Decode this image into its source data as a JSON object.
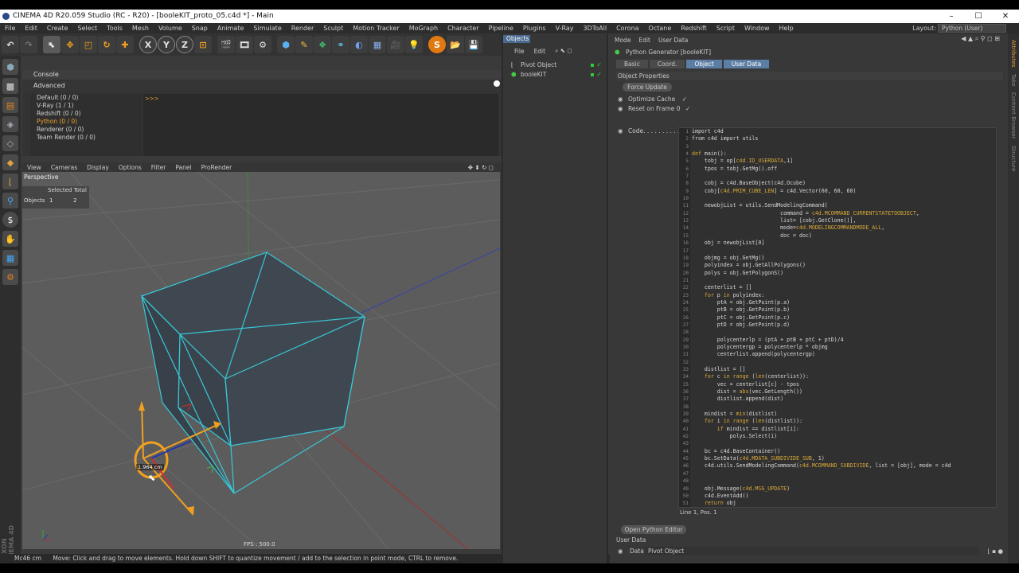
{
  "title": "CINEMA 4D R20.059 Studio (RC - R20) - [booleKIT_proto_05.c4d *] - Main",
  "window_controls": [
    "–",
    "☐",
    "✕"
  ],
  "menu": [
    "File",
    "Edit",
    "Create",
    "Select",
    "Tools",
    "Mesh",
    "Volume",
    "Snap",
    "Animate",
    "Simulate",
    "Render",
    "Sculpt",
    "Motion Tracker",
    "MoGraph",
    "Character",
    "Pipeline",
    "Plugins",
    "V-Ray",
    "3DToAll",
    "Corona",
    "Octane",
    "Redshift",
    "Script",
    "Window",
    "Help"
  ],
  "layout_label": "Layout:",
  "layout_value": "Python (User)",
  "toolbar_axes": [
    "X",
    "Y",
    "Z"
  ],
  "console": {
    "title": "Console",
    "tab": "Advanced",
    "items": [
      "Default (0 / 0)",
      "V-Ray (1 / 1)",
      "Redshift (0 / 0)",
      "Python (0 / 0)",
      "Renderer (0 / 0)",
      "Team Render  (0 / 0)"
    ],
    "prompt": ">>>"
  },
  "viewport": {
    "menu": [
      "View",
      "Cameras",
      "Display",
      "Options",
      "Filter",
      "Panel",
      "ProRender"
    ],
    "name": "Perspective",
    "stats_header": "Selected  Total",
    "stats_label": "Objects",
    "stats_selected": "1",
    "stats_total": "2",
    "measure": "1.964 cm",
    "fps": "FPS : 500.0"
  },
  "status": {
    "left": "Mc46 cm",
    "text": "Move: Click and drag to move elements. Hold down SHIFT to quantize movement / add to the selection in point mode, CTRL to remove."
  },
  "objects": {
    "tab": "Objects",
    "menu": [
      "File",
      "Edit"
    ],
    "items": [
      "Pivot Object",
      "booleKIT"
    ]
  },
  "attributes": {
    "menu": [
      "Mode",
      "Edit",
      "User Data"
    ],
    "header": "Python Generator [booleKIT]",
    "tabs": [
      "Basic",
      "Coord.",
      "Object",
      "User Data"
    ],
    "section": "Object Properties",
    "force_update": "Force Update",
    "optimize_cache": "Optimize Cache",
    "reset_on_frame": "Reset on Frame 0",
    "code_label": "Code. . . . . . . . . .",
    "line_pos": "Line 1, Pos. 1",
    "open_editor": "Open Python Editor",
    "user_data_title": "User Data",
    "data_label": "Data",
    "data_value": "Pivot Object"
  },
  "right_strip": [
    "Attributes",
    "Take",
    "Content Browser",
    "Structure"
  ],
  "code_lines": [
    "import c4d",
    "from c4d import utils",
    "",
    "def main():",
    "    tobj = op[c4d.ID_USERDATA,1]",
    "    tpos = tobj.GetMg().off",
    "",
    "    cobj = c4d.BaseObject(c4d.Ocube)",
    "    cobj[c4d.PRIM_CUBE_LEN] = c4d.Vector(60, 60, 60)",
    "",
    "    newobjList = utils.SendModelingCommand(",
    "                            command = c4d.MCOMMAND_CURRENTSTATETOOBJECT,",
    "                            list= [cobj.GetClone()],",
    "                            mode=c4d.MODELINGCOMMANDMODE_ALL,",
    "                            doc = doc)",
    "    obj = newobjList[0]",
    "",
    "    objmg = obj.GetMg()",
    "    polyindex = obj.GetAllPolygons()",
    "    polys = obj.GetPolygonS()",
    "",
    "    centerlist = []",
    "    for p in polyindex:",
    "        ptA = obj.GetPoint(p.a)",
    "        ptB = obj.GetPoint(p.b)",
    "        ptC = obj.GetPoint(p.c)",
    "        ptD = obj.GetPoint(p.d)",
    "",
    "        polycenterlp = (ptA + ptB + ptC + ptD)/4",
    "        polycentergp = polycenterlp * objmg",
    "        centerlist.append(polycentergp)",
    "",
    "    distlist = []",
    "    for c in range (len(centerlist)):",
    "        vec = centerlist[c] - tpos",
    "        dist = abs(vec.GetLength())",
    "        distlist.append(dist)",
    "",
    "    mindist = min(distlist)",
    "    for i in range (len(distlist)):",
    "        if mindist == distlist[i]:",
    "            polys.Select(i)",
    "",
    "    bc = c4d.BaseContainer()",
    "    bc.SetData(c4d.MDATA_SUBDIVIDE_SUB, 1)",
    "    c4d.utils.SendModelingCommand(c4d.MCOMMAND_SUBDIVIDE, list = [obj], mode = c4d",
    "",
    "",
    "    obj.Message(c4d.MSG_UPDATE)",
    "    c4d.EventAdd()",
    "    return obj"
  ]
}
